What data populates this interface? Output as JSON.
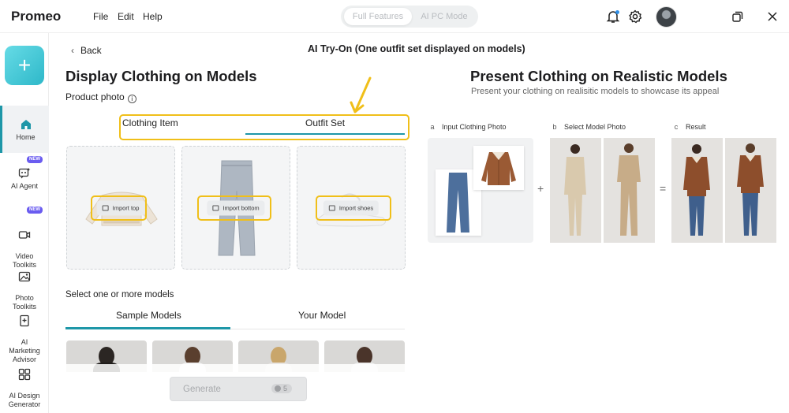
{
  "app": {
    "brand": "Promeo",
    "menu": [
      "File",
      "Edit",
      "Help"
    ],
    "modes": {
      "full": "Full Features",
      "pc": "AI PC Mode"
    }
  },
  "sidebar": {
    "add_label": "+",
    "new_badge": "NEW",
    "items": [
      {
        "label": "Home",
        "icon": "home-icon",
        "active": true
      },
      {
        "label": "AI Agent",
        "icon": "ai-agent-icon",
        "badge": true
      },
      {
        "label": "Video\nToolkits",
        "icon": "video-icon",
        "badge": true
      },
      {
        "label": "Photo\nToolkits",
        "icon": "photo-icon"
      },
      {
        "label": "AI\nMarketing\nAdvisor",
        "icon": "marketing-icon"
      },
      {
        "label": "AI Design\nGenerator",
        "icon": "design-grid-icon"
      }
    ]
  },
  "header": {
    "back": "Back",
    "title": "AI Try-On (One outfit set displayed on models)"
  },
  "left": {
    "heading": "Display Clothing on Models",
    "product_label": "Product photo",
    "tabs": {
      "item": "Clothing Item",
      "set": "Outfit Set"
    },
    "slots": {
      "top": "Import top",
      "bottom": "Import bottom",
      "shoes": "Import shoes"
    },
    "select_label": "Select one or more models",
    "model_tabs": {
      "sample": "Sample Models",
      "yours": "Your Model"
    },
    "generate": {
      "label": "Generate",
      "credits": "5"
    }
  },
  "right": {
    "heading": "Present Clothing on Realistic Models",
    "sub": "Present your clothing on realisitic models to showcase its appeal",
    "steps": [
      {
        "letter": "a",
        "label": "Input Clothing Photo"
      },
      {
        "letter": "b",
        "label": "Select Model Photo"
      },
      {
        "letter": "c",
        "label": "Result"
      }
    ],
    "plus": "+",
    "equals": "="
  },
  "colors": {
    "accent": "#1e97a8",
    "highlight": "#f0bf19",
    "badge": "#6a5cf0"
  }
}
